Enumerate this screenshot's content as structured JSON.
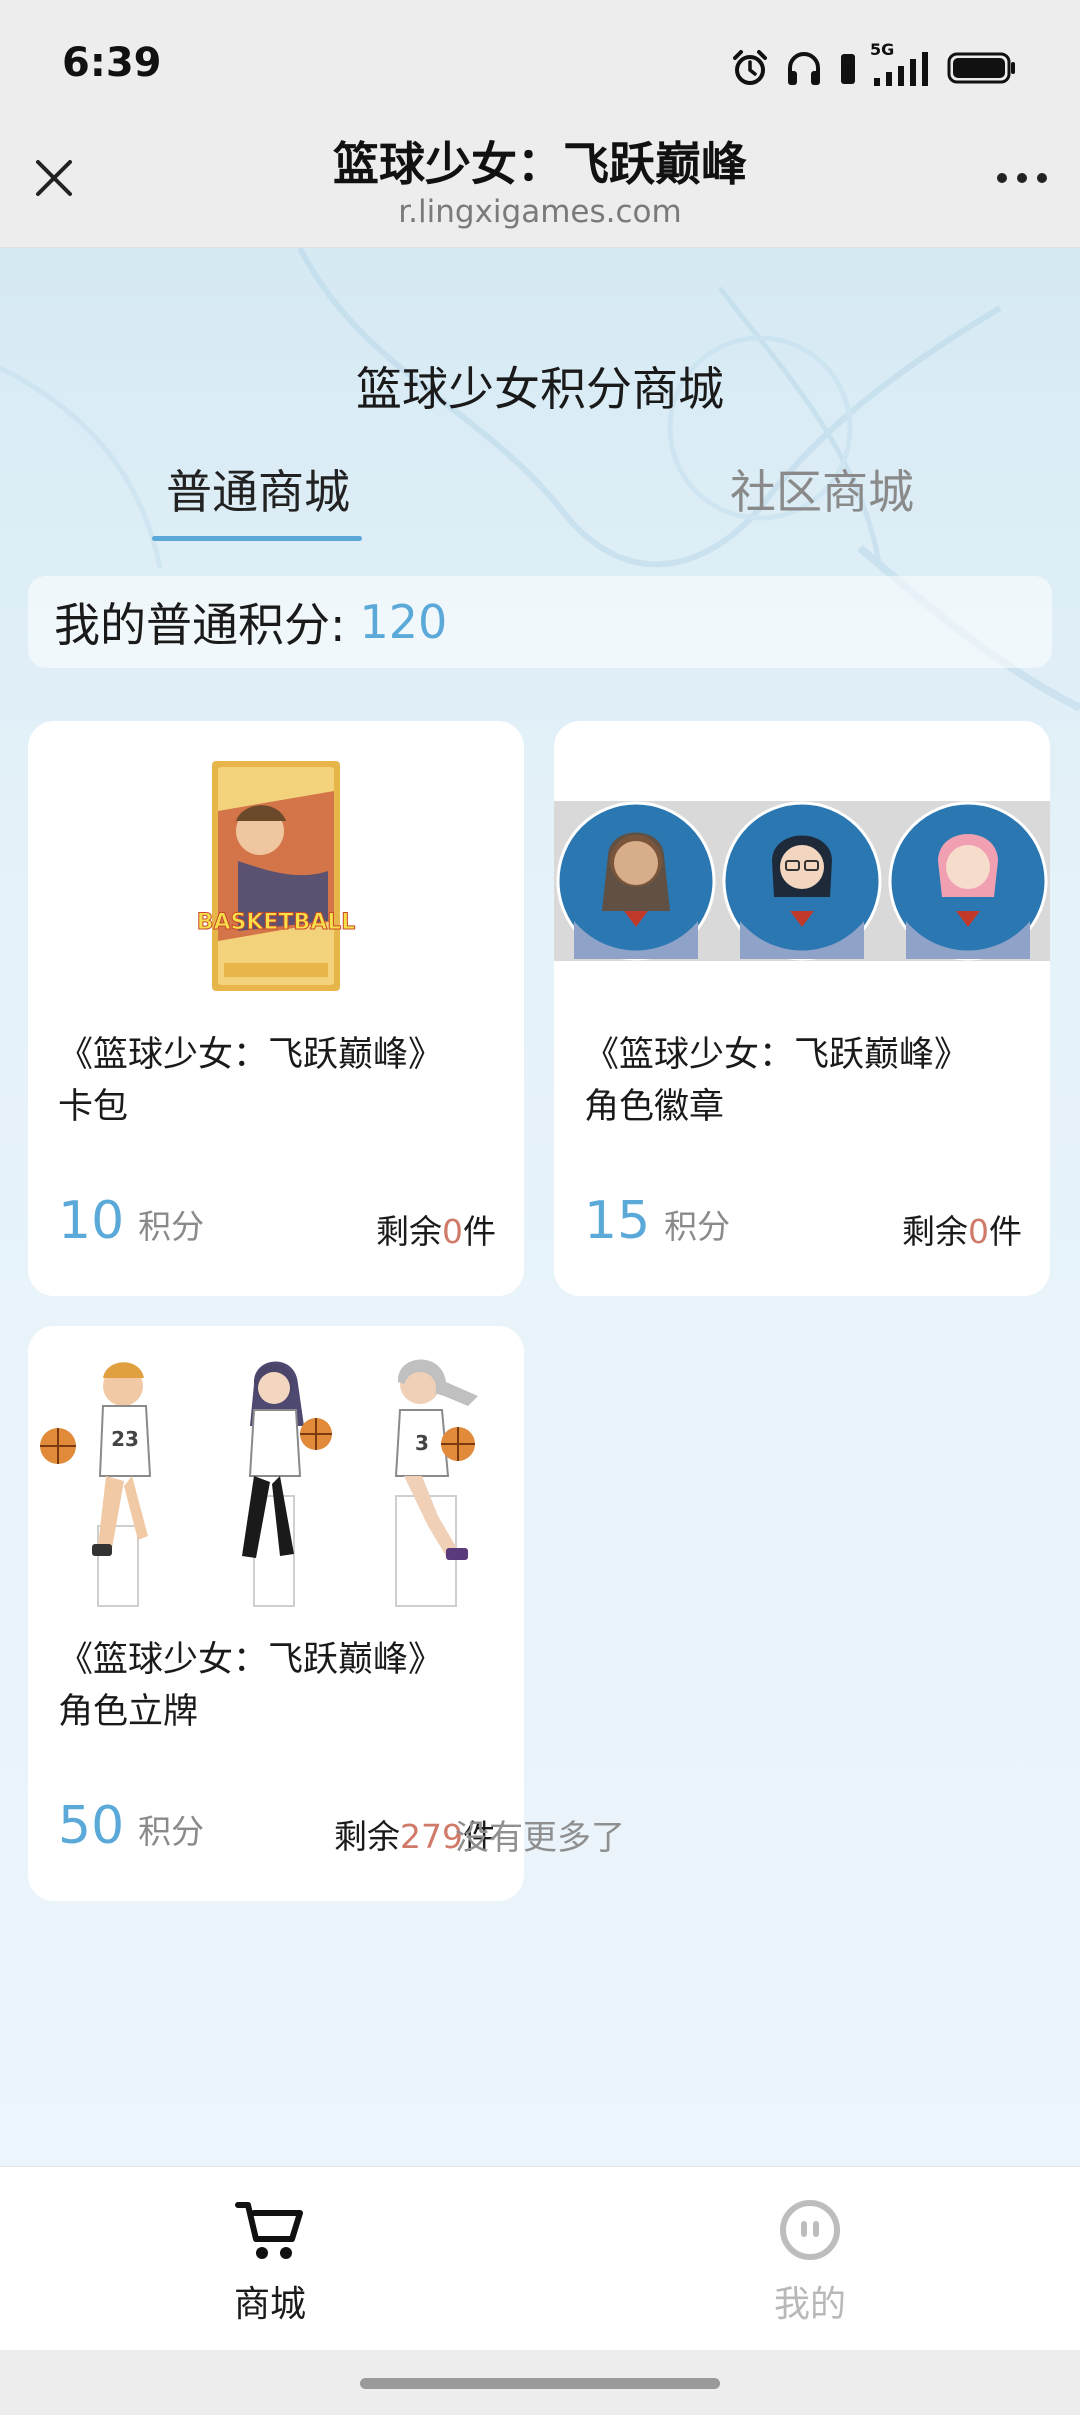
{
  "status_bar": {
    "time": "6:39",
    "network": "5G",
    "icons": [
      "alarm-icon",
      "headphones-icon",
      "phone-icon",
      "signal-icon",
      "battery-icon"
    ]
  },
  "title_bar": {
    "title": "篮球少女：飞跃巅峰",
    "url": "r.lingxigames.com",
    "icons": [
      "close-icon",
      "more-icon"
    ]
  },
  "main": {
    "shop_title": "篮球少女积分商城",
    "tabs": [
      {
        "label": "普通商城",
        "active": true
      },
      {
        "label": "社区商城",
        "active": false
      }
    ],
    "points": {
      "label": "我的普通积分:",
      "value": "120"
    },
    "products": [
      {
        "name_line1": "《篮球少女：飞跃巅峰》",
        "name_line2": "卡包",
        "price": "10",
        "price_unit": "积分",
        "stock_prefix": "剩余",
        "stock": "0",
        "stock_suffix": "件",
        "image_label": "BASKETBALL"
      },
      {
        "name_line1": "《篮球少女：飞跃巅峰》",
        "name_line2": "角色徽章",
        "price": "15",
        "price_unit": "积分",
        "stock_prefix": "剩余",
        "stock": "0",
        "stock_suffix": "件"
      },
      {
        "name_line1": "《篮球少女：飞跃巅峰》",
        "name_line2": "角色立牌",
        "price": "50",
        "price_unit": "积分",
        "stock_prefix": "剩余",
        "stock": "279",
        "stock_suffix": "件",
        "jersey_numbers": [
          "23",
          "3"
        ]
      }
    ],
    "no_more": "没有更多了"
  },
  "bottom_nav": {
    "items": [
      {
        "label": "商城",
        "icon": "cart-icon",
        "active": true
      },
      {
        "label": "我的",
        "icon": "profile-icon",
        "active": false
      }
    ]
  },
  "colors": {
    "accent": "#5aa9d8",
    "stock_number": "#d07a6a",
    "muted": "#8a8a8a"
  }
}
